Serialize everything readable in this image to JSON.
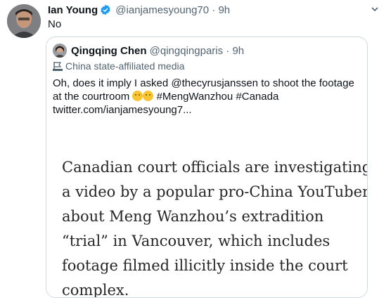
{
  "tweet": {
    "display_name": "Ian Young",
    "handle": "@ianjamesyoung70",
    "separator": "·",
    "time": "9h",
    "text": "No"
  },
  "quote": {
    "display_name": "Qingqing Chen",
    "handle": "@qingqingparis",
    "separator": "·",
    "time": "9h",
    "label": "China state-affiliated media",
    "text_part1": "Oh, does it imply I asked @thecyrusjanssen to shoot the footage at the courtroom",
    "text_part2": "#MengWanzhou #Canada",
    "link": "twitter.com/ianjamesyoung7...",
    "image_lines": [
      "Canadian court officials are investigating",
      "a video by a popular pro-China YouTuber",
      "about Meng Wanzhou’s extradition",
      "“trial” in Vancouver, which includes",
      "footage filmed illicitly inside the court",
      "complex."
    ]
  },
  "icons": {
    "verified": "verified-badge-icon",
    "more": "chevron-down-icon",
    "state_media": "state-media-flag-icon"
  },
  "colors": {
    "text": "#0f1419",
    "muted": "#536471",
    "verified": "#1d9bf0",
    "border": "#cfd9de"
  }
}
